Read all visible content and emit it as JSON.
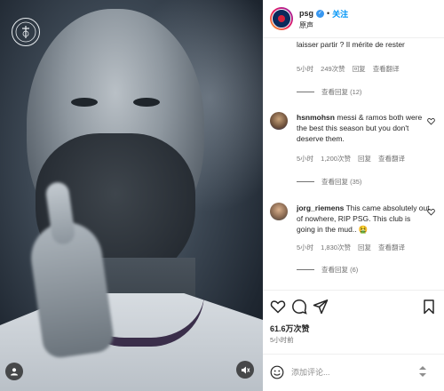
{
  "media": {
    "logo_text": "PARIS\nSAINT-GERMAIN",
    "user_icon": "user-icon",
    "mute_icon": "mute-icon"
  },
  "header": {
    "username": "psg",
    "separator": "•",
    "follow_label": "关注",
    "audio_label": "原声",
    "verified_icon": "verified-badge-icon"
  },
  "comments": [
    {
      "user": "",
      "text": "laisser partir ? Il mérite de rester",
      "time": "5小时",
      "likes": "249次赞",
      "reply_label": "回复",
      "translate_label": "查看翻译",
      "view_replies": "查看回复 (12)"
    },
    {
      "user": "hsnmohsn",
      "text": "messi & ramos both were the best this season but you don't deserve them.",
      "time": "5小时",
      "likes": "1,200次赞",
      "reply_label": "回复",
      "translate_label": "查看翻译",
      "view_replies": "查看回复 (35)"
    },
    {
      "user": "jorg_riemens",
      "text": "This came absolutely out of nowhere, RIP PSG. This club is going in the mud.. 🤮",
      "time": "5小时",
      "likes": "1,830次赞",
      "reply_label": "回复",
      "translate_label": "查看翻译",
      "view_replies": "查看回复 (6)"
    }
  ],
  "actions": {
    "like_icon": "heart-icon",
    "comment_icon": "comment-icon",
    "share_icon": "share-icon",
    "save_icon": "bookmark-icon"
  },
  "likes_count": "61.6万次赞",
  "posted_time": "5小时前",
  "comment_input": {
    "placeholder": "添加评论...",
    "value": "",
    "emoji_icon": "emoji-icon",
    "send_icon": "post-arrows-icon"
  },
  "colors": {
    "accent": "#0095f6",
    "muted": "#737373",
    "text": "#262626",
    "verified": "#3897f0"
  }
}
